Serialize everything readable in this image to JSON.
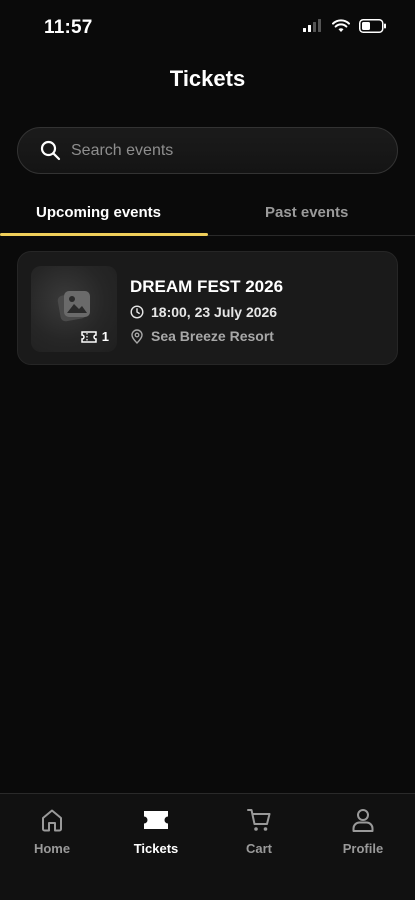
{
  "status_bar": {
    "time": "11:57"
  },
  "header": {
    "title": "Tickets"
  },
  "search": {
    "placeholder": "Search events"
  },
  "tabs": [
    {
      "label": "Upcoming events",
      "active": true
    },
    {
      "label": "Past events",
      "active": false
    }
  ],
  "colors": {
    "accent": "#f0cf5a",
    "background": "#0a0a0a",
    "card": "#1a1a1a"
  },
  "events": [
    {
      "title": "DREAM FEST 2026",
      "datetime": "18:00, 23 July 2026",
      "venue": "Sea Breeze Resort",
      "ticket_count": "1"
    }
  ],
  "bottom_nav": [
    {
      "label": "Home",
      "icon": "home-icon",
      "active": false
    },
    {
      "label": "Tickets",
      "icon": "ticket-icon",
      "active": true
    },
    {
      "label": "Cart",
      "icon": "cart-icon",
      "active": false
    },
    {
      "label": "Profile",
      "icon": "profile-icon",
      "active": false
    }
  ]
}
